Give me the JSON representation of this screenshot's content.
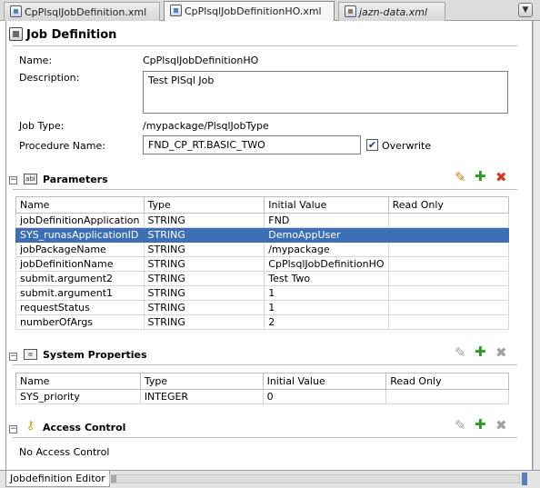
{
  "tabs": [
    {
      "label": "CpPlsqlJobDefinition.xml",
      "active": false
    },
    {
      "label": "CpPlsqlJobDefinitionHO.xml",
      "active": true
    },
    {
      "label": "jazn-data.xml",
      "active": false
    }
  ],
  "page": {
    "title": "Job Definition",
    "fields": {
      "name_label": "Name:",
      "name_value": "CpPlsqlJobDefinitionHO",
      "description_label": "Description:",
      "description_value": "Test PlSql Job",
      "jobtype_label": "Job Type:",
      "jobtype_value": "/mypackage/PlsqlJobType",
      "procedure_label": "Procedure Name:",
      "procedure_value": "FND_CP_RT.BASIC_TWO",
      "overwrite_label": "Overwrite",
      "overwrite_checked": true
    }
  },
  "parameters": {
    "title": "Parameters",
    "icon_label": "abl",
    "columns": [
      "Name",
      "Type",
      "Initial Value",
      "Read Only"
    ],
    "rows": [
      [
        "jobDefinitionApplication",
        "STRING",
        "FND",
        ""
      ],
      [
        "SYS_runasApplicationID",
        "STRING",
        "DemoAppUser",
        ""
      ],
      [
        "jobPackageName",
        "STRING",
        "/mypackage",
        ""
      ],
      [
        "jobDefinitionName",
        "STRING",
        "CpPlsqlJobDefinitionHO",
        ""
      ],
      [
        "submit.argument2",
        "STRING",
        "Test Two",
        ""
      ],
      [
        "submit.argument1",
        "STRING",
        "1",
        ""
      ],
      [
        "requestStatus",
        "STRING",
        "1",
        ""
      ],
      [
        "numberOfArgs",
        "STRING",
        "2",
        ""
      ]
    ],
    "selected_row": 1
  },
  "system_properties": {
    "title": "System Properties",
    "columns": [
      "Name",
      "Type",
      "Initial Value",
      "Read Only"
    ],
    "rows": [
      [
        "SYS_priority",
        "INTEGER",
        "0",
        ""
      ]
    ]
  },
  "access_control": {
    "title": "Access Control",
    "empty_text": "No Access Control"
  },
  "icons": {
    "edit": "pencil-icon",
    "add": "plus-icon",
    "delete": "x-icon",
    "menu": "chevron-down-icon"
  },
  "bottom": {
    "editor_tab": "Jobdefinition Editor"
  },
  "colors": {
    "selection": "#3c6fb5",
    "add": "#2a9b2a",
    "delete": "#d43a2a",
    "edit": "#c47f12"
  }
}
